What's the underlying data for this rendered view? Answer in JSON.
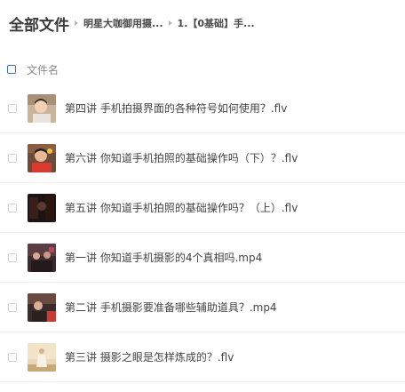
{
  "breadcrumb": {
    "root": "全部文件",
    "items": [
      "明星大咖御用摄...",
      "1.【0基础】手..."
    ]
  },
  "list_header": {
    "column_label": "文件名"
  },
  "files": [
    {
      "name": "第四讲 手机拍摄界面的各种符号如何使用？.flv"
    },
    {
      "name": "第六讲 你知道手机拍照的基础操作吗（下）？.flv"
    },
    {
      "name": "第五讲 你知道手机拍照的基础操作吗？（上）.flv"
    },
    {
      "name": "第一讲 你知道手机摄影的4个真相吗.mp4"
    },
    {
      "name": "第二讲 手机摄影要准备哪些辅助道具？.mp4"
    },
    {
      "name": "第三讲 摄影之眼是怎样炼成的？.flv"
    }
  ]
}
